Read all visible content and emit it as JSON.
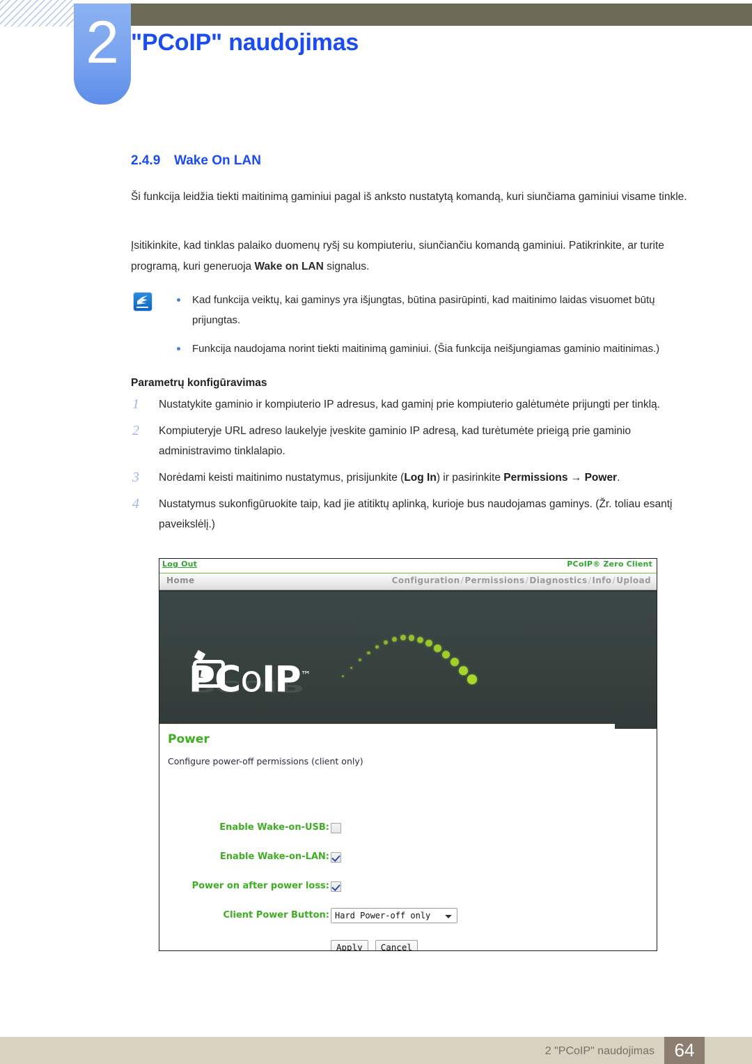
{
  "header": {
    "chapter_number": "2",
    "chapter_title": "\"PCoIP\" naudojimas"
  },
  "section": {
    "number": "2.4.9",
    "title": "Wake On LAN"
  },
  "paragraphs": {
    "p1": "Ši funkcija leidžia tiekti maitinimą gaminiui pagal iš anksto nustatytą komandą, kuri siunčiama gaminiui visame tinkle.",
    "p2_before": "Įsitikinkite, kad tinklas palaiko duomenų ryšį su kompiuteriu, siunčiančiu komandą gaminiui. Patikrinkite, ar turite programą, kuri generuoja ",
    "p2_bold": "Wake on LAN",
    "p2_after": " signalus."
  },
  "note": {
    "icon": "note-pencil-icon",
    "bullets": [
      "Kad funkcija veiktų, kai gaminys yra išjungtas, būtina pasirūpinti, kad maitinimo laidas visuomet būtų prijungtas.",
      "Funkcija naudojama norint tiekti maitinimą gaminiui. (Šia funkcija neišjungiamas gaminio maitinimas.)"
    ]
  },
  "config": {
    "subheading": "Parametrų konfigūravimas",
    "steps": [
      {
        "num": "1",
        "text": "Nustatykite gaminio ir kompiuterio IP adresus, kad gaminį prie kompiuterio galėtumėte prijungti per tinklą."
      },
      {
        "num": "2",
        "text": "Kompiuteryje URL adreso laukelyje įveskite gaminio IP adresą, kad turėtumėte prieigą prie gaminio administravimo tinklalapio."
      },
      {
        "num": "3",
        "text_before": "Norėdami keisti maitinimo nustatymus, prisijunkite (",
        "bold1": "Log In",
        "text_mid": ") ir pasirinkite ",
        "bold2": "Permissions → Power",
        "text_after": "."
      },
      {
        "num": "4",
        "text": "Nustatymus sukonfigūruokite taip, kad jie atitiktų aplinką, kurioje bus naudojamas gaminys. (Žr. toliau esantį paveikslėlį.)"
      }
    ]
  },
  "screenshot": {
    "topbar": {
      "logout_label": "Log Out",
      "product_label": "PCoIP® Zero Client"
    },
    "nav": {
      "home_label": "Home",
      "items": [
        "Configuration",
        "Permissions",
        "Diagnostics",
        "Info",
        "Upload"
      ],
      "separator": "/"
    },
    "hero": {
      "logo_text_pc": "PC",
      "logo_text_o": "o",
      "logo_text_ip": "IP",
      "logo_tm": "™"
    },
    "panel": {
      "title": "Power",
      "description": "Configure power-off permissions (client only)",
      "fields": [
        {
          "label": "Enable Wake-on-USB:",
          "type": "checkbox",
          "checked": false
        },
        {
          "label": "Enable Wake-on-LAN:",
          "type": "checkbox",
          "checked": true
        },
        {
          "label": "Power on after power loss:",
          "type": "checkbox",
          "checked": true
        },
        {
          "label": "Client Power Button:",
          "type": "select",
          "value": "Hard Power-off only"
        }
      ],
      "buttons": {
        "apply": "Apply",
        "cancel": "Cancel"
      }
    }
  },
  "footer": {
    "text": "2 \"PCoIP\" naudojimas",
    "page": "64"
  },
  "colors": {
    "accent_blue": "#1b4cf0",
    "header_bar": "#6d6b57",
    "badge_blue": "#79a3ef",
    "app_green": "#3fae23",
    "link_green": "#2fa62f",
    "hero_dark": "#37423f",
    "footer_bg": "#d8d2c0",
    "footer_page_bg": "#8c7f72"
  }
}
